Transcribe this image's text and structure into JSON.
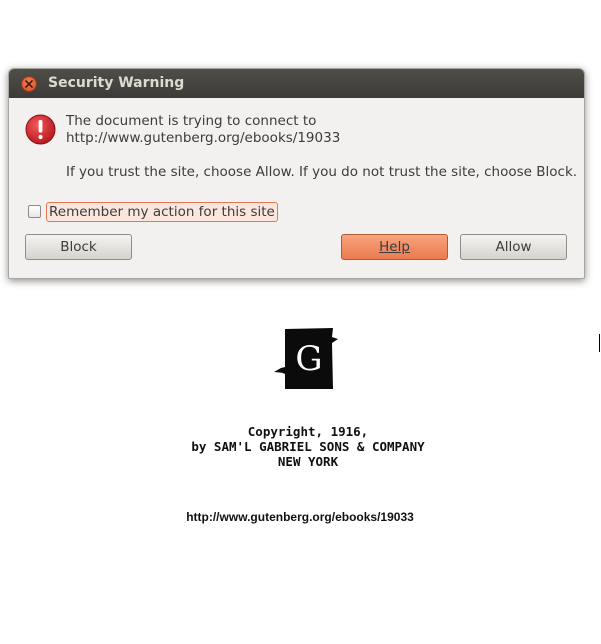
{
  "dialog": {
    "title": "Security Warning",
    "message_line1": "The document is trying to connect to",
    "message_line2": "http://www.gutenberg.org/ebooks/19033",
    "message_line3": "If you trust the site, choose Allow. If you do not trust the site, choose Block.",
    "remember_label": "Remember my action for this site",
    "remember_checked": false,
    "buttons": {
      "block": "Block",
      "help": "Help",
      "allow": "Allow"
    },
    "icons": {
      "close": "close-icon",
      "warning": "warning-icon"
    },
    "colors": {
      "titlebar": "#3c3b37",
      "accent": "#ec7a4f",
      "warning": "#d9262c"
    }
  },
  "document": {
    "logo_letter": "G",
    "copyright_lines": [
      "Copyright, 1916,",
      "by SAM'L GABRIEL SONS & COMPANY",
      "NEW YORK"
    ],
    "url": "http://www.gutenberg.org/ebooks/19033"
  }
}
